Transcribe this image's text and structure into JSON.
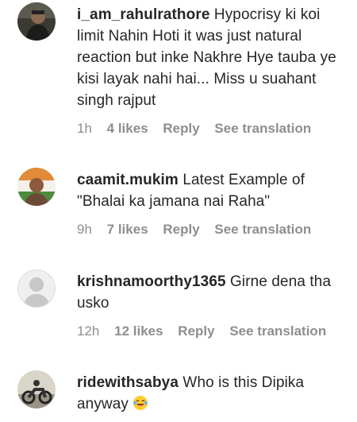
{
  "comments": [
    {
      "username": "i_am_rahulrathore",
      "text": "Hypocrisy ki koi limit Nahin Hoti it was just natural reaction but inke Nakhre Hye tauba ye kisi layak nahi hai... Miss u suahant singh rajput",
      "time": "1h",
      "likes": "4 likes",
      "reply": "Reply",
      "translation": "See translation",
      "avatar_icon": "profile-photo-dark-person"
    },
    {
      "username": "caamit.mukim",
      "text": "Latest Example of \"Bhalai ka jamana nai Raha\"",
      "time": "9h",
      "likes": "7 likes",
      "reply": "Reply",
      "translation": "See translation",
      "avatar_icon": "profile-photo-flag-person"
    },
    {
      "username": "krishnamoorthy1365",
      "text": "Girne dena tha usko",
      "time": "12h",
      "likes": "12 likes",
      "reply": "Reply",
      "translation": "See translation",
      "avatar_icon": "default-avatar-icon"
    },
    {
      "username": "ridewithsabya",
      "text": "Who is this Dipika anyway",
      "emoji": "laughing-tears-emoji",
      "avatar_icon": "profile-photo-motorcycle"
    }
  ],
  "colors": {
    "text": "#262626",
    "meta": "#8e8e8e",
    "background": "#ffffff"
  }
}
